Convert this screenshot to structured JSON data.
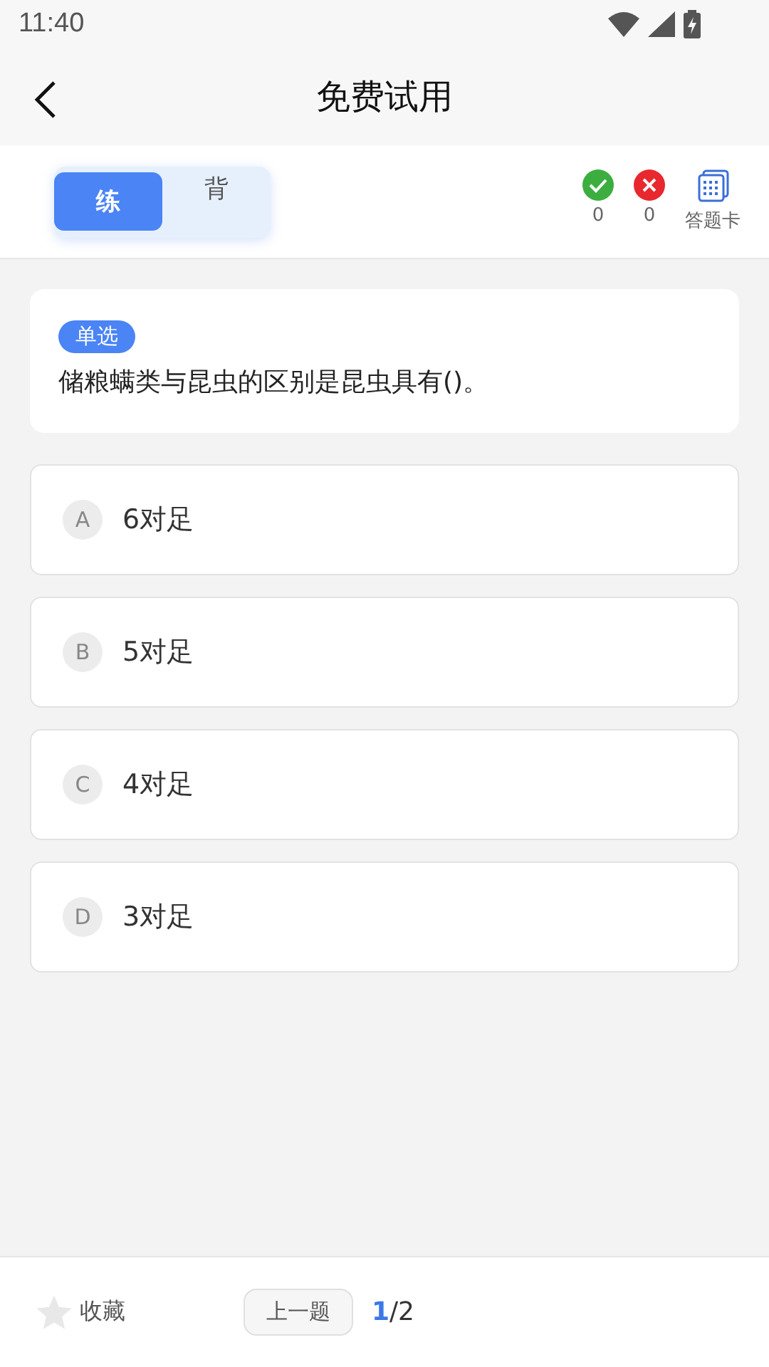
{
  "status_bar": {
    "time": "11:40"
  },
  "header": {
    "title": "免费试用"
  },
  "mode_tabs": [
    {
      "label": "练",
      "selected": true
    },
    {
      "label": "背",
      "selected": false
    }
  ],
  "stats": [
    {
      "kind": "correct",
      "count": "0"
    },
    {
      "kind": "wrong",
      "count": "0"
    },
    {
      "kind": "card",
      "label": "答题卡"
    }
  ],
  "question": {
    "type": "单选",
    "text": "储粮螨类与昆虫的区别是昆虫具有()。"
  },
  "options": [
    {
      "letter": "A",
      "text": "6对足",
      "selected": false
    },
    {
      "letter": "B",
      "text": "5对足",
      "selected": false
    },
    {
      "letter": "C",
      "text": "4对足",
      "selected": false
    },
    {
      "letter": "D",
      "text": "3对足",
      "selected": false
    }
  ],
  "bottom_bar": {
    "favorite": {
      "label": "收藏",
      "starred": false
    },
    "prev_button": "上一题",
    "page": {
      "current": "1",
      "total": "/2"
    }
  }
}
